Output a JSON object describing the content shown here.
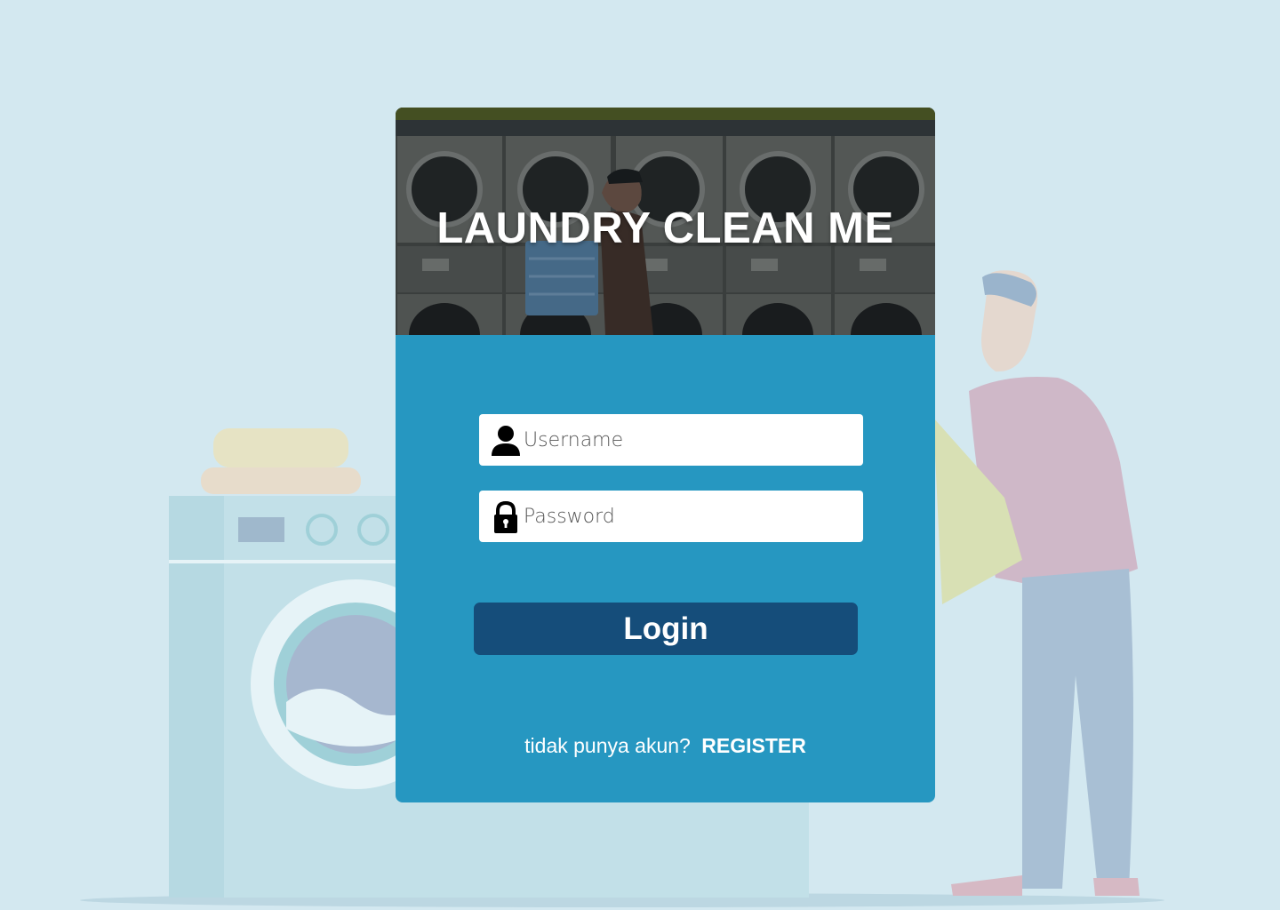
{
  "app": {
    "title": "LAUNDRY CLEAN ME"
  },
  "form": {
    "username_placeholder": "Username",
    "username_value": "",
    "password_placeholder": "Password",
    "password_value": "",
    "login_label": "Login"
  },
  "footer": {
    "prompt": "tidak punya akun?",
    "register_label": "REGISTER"
  },
  "icons": {
    "username": "user-icon",
    "password": "lock-icon"
  },
  "colors": {
    "page_background": "#d3e8f0",
    "card_background": "#2697c1",
    "login_button": "#154d7a",
    "input_background": "#ffffff",
    "text_light": "#ffffff"
  }
}
